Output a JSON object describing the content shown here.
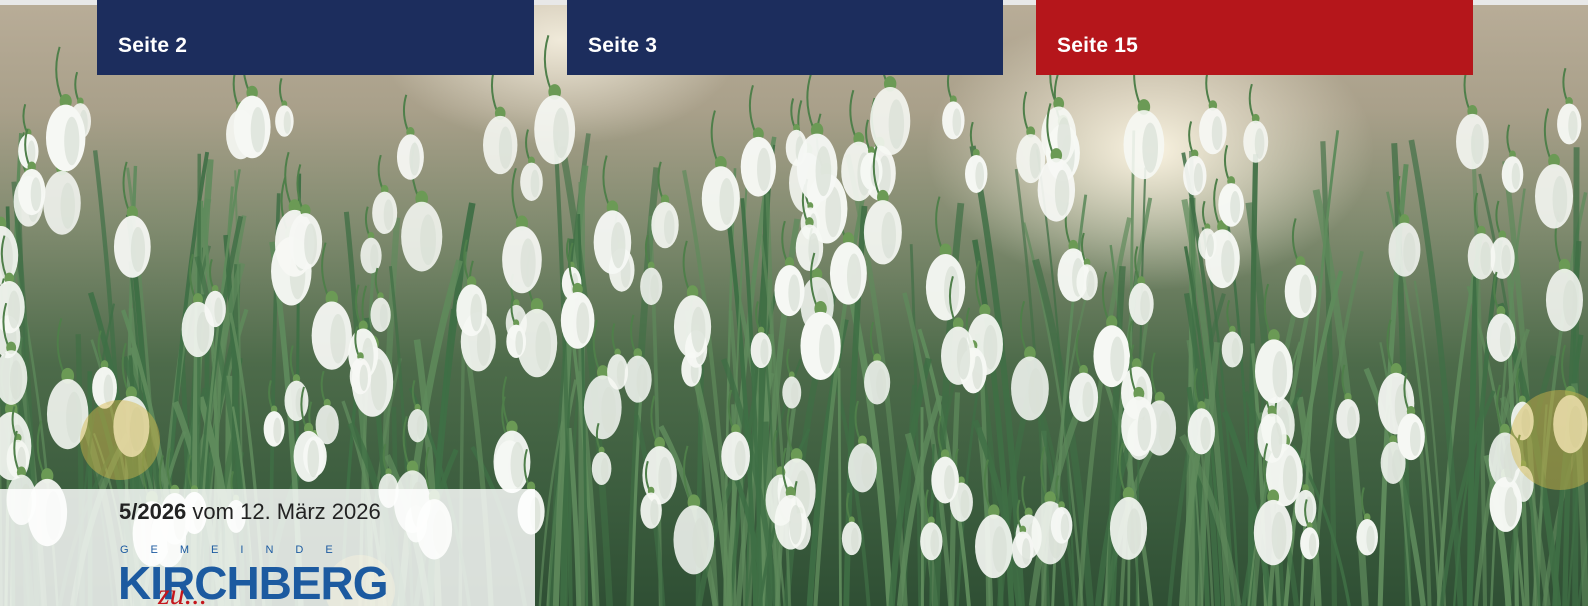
{
  "tiles": [
    {
      "label": "Seite 2",
      "color": "#1c2d5d"
    },
    {
      "label": "Seite 3",
      "color": "#1c2d5d"
    },
    {
      "label": "Seite 15",
      "color": "#b5161b"
    }
  ],
  "issue": {
    "number": "5/2026",
    "date_text": "vom 12. März 2026"
  },
  "logo": {
    "top": "GEMEINDE",
    "main": "KIRCHBERG",
    "script": "zu..."
  },
  "photo": {
    "subject": "snowdrops-photo"
  }
}
